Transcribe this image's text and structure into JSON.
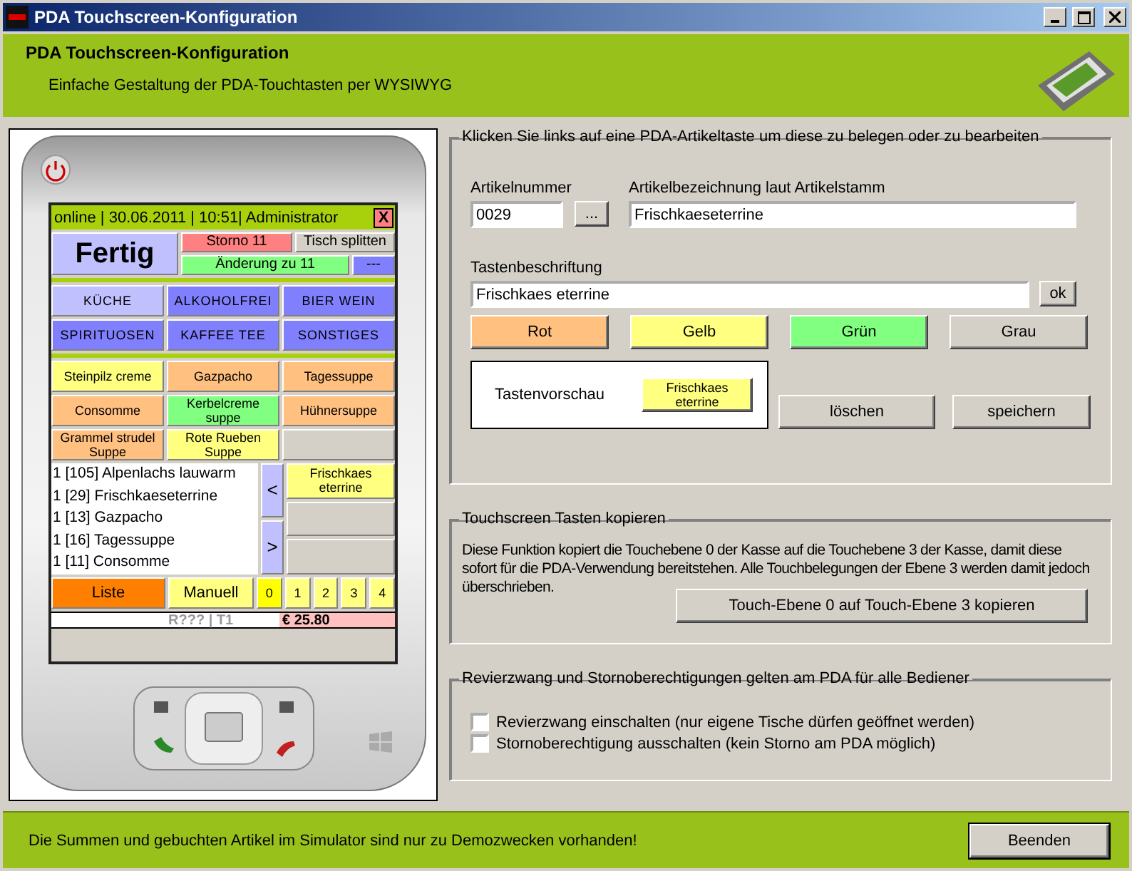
{
  "window": {
    "title": "PDA Touchscreen-Konfiguration"
  },
  "header": {
    "title": "PDA Touchscreen-Konfiguration",
    "subtitle": "Einfache Gestaltung der PDA-Touchtasten per WYSIWYG"
  },
  "pda": {
    "status": "online | 30.06.2011 | 10:51| Administrator",
    "close": "X",
    "done": "Fertig",
    "storno": "Storno 11",
    "split": "Tisch splitten",
    "change": "Änderung zu 11",
    "more": "---",
    "categories": [
      {
        "label": "KÜCHE",
        "selected": true
      },
      {
        "label": "ALKOHOLFREI",
        "selected": false
      },
      {
        "label": "BIER WEIN",
        "selected": false
      },
      {
        "label": "SPIRITUOSEN",
        "selected": false
      },
      {
        "label": "KAFFEE TEE",
        "selected": false
      },
      {
        "label": "SONSTIGES",
        "selected": false
      }
    ],
    "items": [
      {
        "kind": "key",
        "label": "Steinpilz creme",
        "color": "#ffff80"
      },
      {
        "kind": "key",
        "label": "Gazpacho",
        "color": "#ffc080"
      },
      {
        "kind": "key",
        "label": "Tagessuppe",
        "color": "#ffc080"
      },
      {
        "kind": "key",
        "label": "Consomme",
        "color": "#ffc080"
      },
      {
        "kind": "key",
        "label": "Kerbelcreme suppe",
        "color": "#80ff80"
      },
      {
        "kind": "key",
        "label": "Hühnersuppe",
        "color": "#ffc080"
      },
      {
        "kind": "key",
        "label": "Grammel strudel Suppe",
        "color": "#ffc080"
      },
      {
        "kind": "key",
        "label": "Rote Rueben Suppe",
        "color": "#ffff80"
      },
      {
        "kind": "empty"
      }
    ],
    "order_list": [
      "1 [105] Alpenlachs lauwarm",
      "1 [29] Frischkaeseterrine",
      "1 [13] Gazpacho",
      "1 [16] Tagessuppe",
      "1 [11] Consomme"
    ],
    "prev": "<",
    "next": ">",
    "side_keys": [
      {
        "kind": "key",
        "label": "Frischkaes eterrine",
        "color": "#ffff80"
      },
      {
        "kind": "empty"
      },
      {
        "kind": "empty"
      }
    ],
    "list_button": "Liste",
    "manual_button": "Manuell",
    "levels": [
      {
        "label": "0",
        "selected": true
      },
      {
        "label": "1",
        "selected": false
      },
      {
        "label": "2",
        "selected": false
      },
      {
        "label": "3",
        "selected": false
      },
      {
        "label": "4",
        "selected": false
      }
    ],
    "room_table": "R??? | T1",
    "total": "€ 25.80"
  },
  "editor": {
    "legend": "Klicken Sie links auf eine PDA-Artikeltaste um diese zu belegen oder zu bearbeiten",
    "number_label": "Artikelnummer",
    "number": "0029",
    "browse": "...",
    "name_label": "Artikelbezeichnung laut Artikelstamm",
    "name": "Frischkaeseterrine",
    "caption_label": "Tastenbeschriftung",
    "caption": "Frischkaes eterrine",
    "ok": "ok",
    "colors": [
      {
        "label": "Rot",
        "color": "#ffc080"
      },
      {
        "label": "Gelb",
        "color": "#ffff80"
      },
      {
        "label": "Grün",
        "color": "#80ff80"
      },
      {
        "label": "Grau",
        "color": "#d4d0c8"
      }
    ],
    "preview_label": "Tastenvorschau",
    "preview_key": {
      "label": "Frischkaes eterrine",
      "color": "#ffff80"
    },
    "delete": "löschen",
    "save": "speichern"
  },
  "copy": {
    "legend": "Touchscreen Tasten kopieren",
    "text": "Diese Funktion kopiert die Touchebene 0 der Kasse auf die Touchebene 3 der Kasse, damit diese sofort für die PDA-Verwendung bereitstehen. Alle Touchbelegungen der Ebene 3 werden damit jedoch überschrieben.",
    "button": "Touch-Ebene 0 auf Touch-Ebene 3 kopieren"
  },
  "rights": {
    "legend": "Revierzwang und Stornoberechtigungen gelten am PDA für alle Bediener",
    "options": [
      {
        "label": "Revierzwang einschalten (nur eigene Tische dürfen geöffnet werden)",
        "checked": false
      },
      {
        "label": "Stornoberechtigung ausschalten (kein Storno am PDA möglich)",
        "checked": false
      }
    ]
  },
  "footer": {
    "text": "Die Summen und gebuchten Artikel im Simulator sind nur zu Demozwecken vorhanden!",
    "button": "Beenden"
  }
}
